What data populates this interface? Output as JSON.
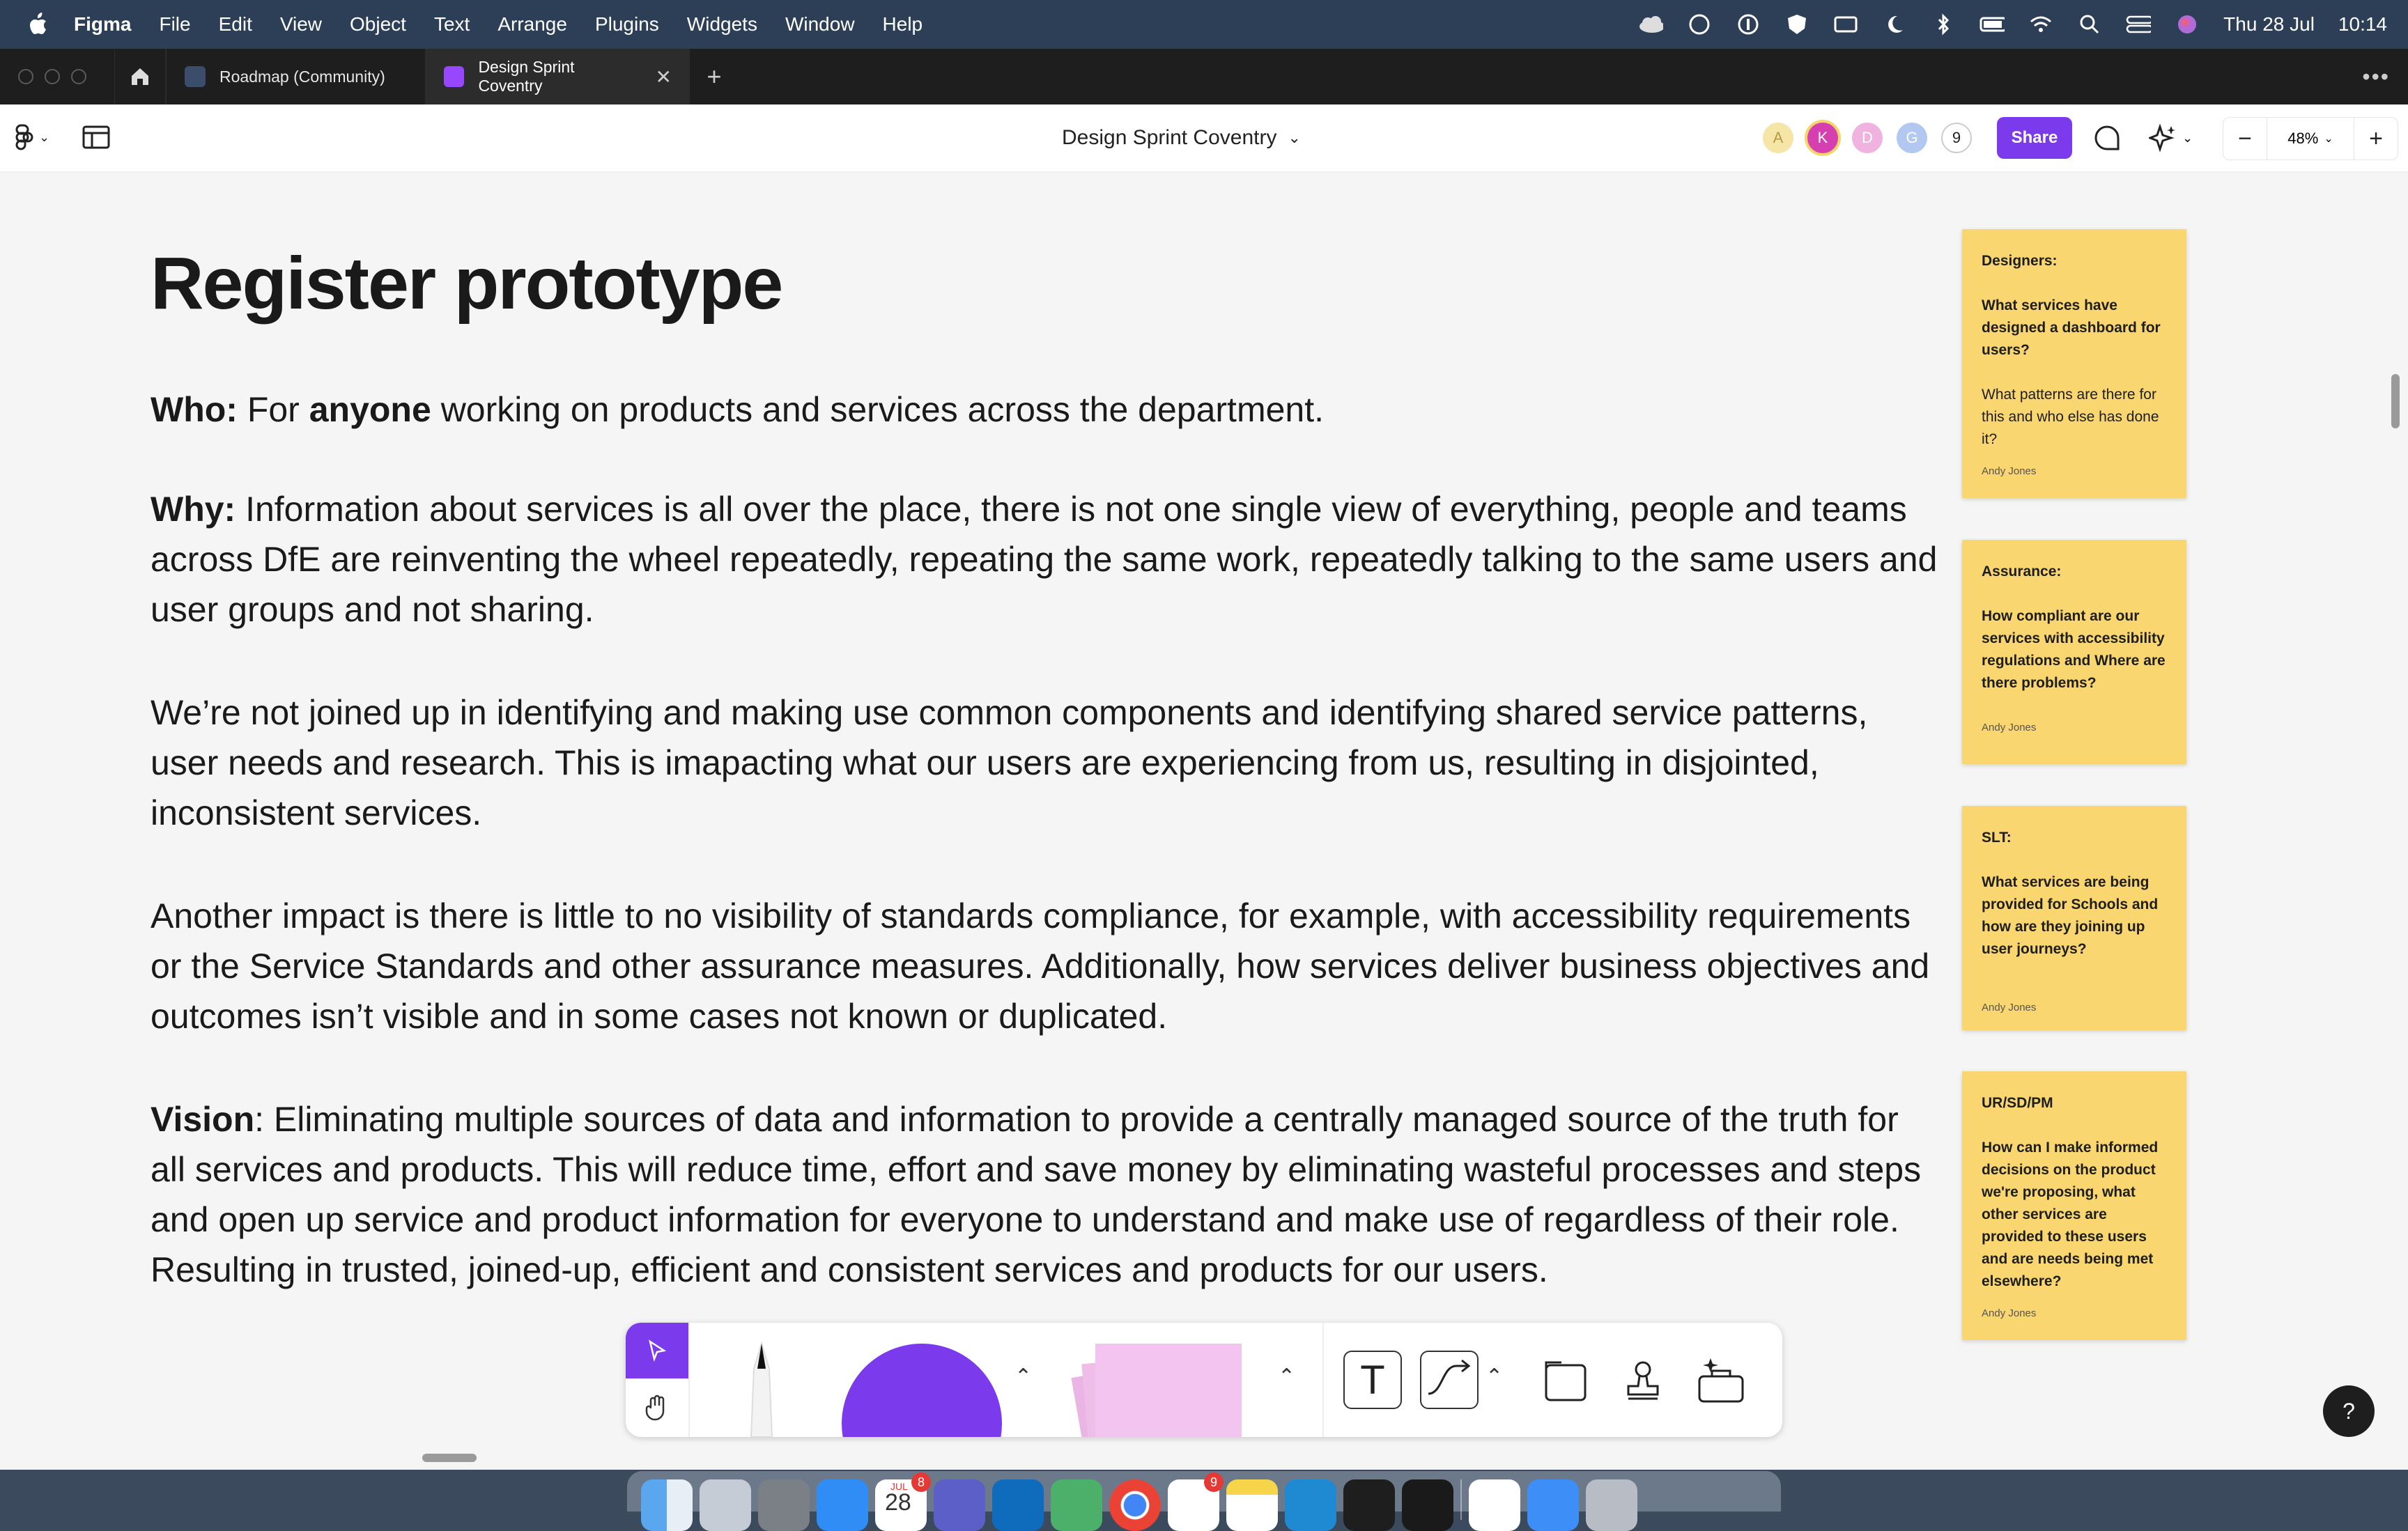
{
  "menubar": {
    "app_name": "Figma",
    "items": [
      "File",
      "Edit",
      "View",
      "Object",
      "Text",
      "Arrange",
      "Plugins",
      "Widgets",
      "Window",
      "Help"
    ],
    "date": "Thu 28 Jul",
    "time": "10:14"
  },
  "tabs": [
    {
      "label": "Roadmap (Community)",
      "icon": "figjam-file-icon",
      "active": false
    },
    {
      "label": "Design Sprint Coventry",
      "icon": "figjam-file-icon",
      "active": true
    }
  ],
  "toolbar": {
    "document_title": "Design Sprint Coventry",
    "avatars": [
      {
        "initial": "A",
        "color": "#f5e6a8"
      },
      {
        "initial": "K",
        "color": "#d63fb0"
      },
      {
        "initial": "D",
        "color": "#f0b3e0"
      },
      {
        "initial": "G",
        "color": "#b3c8f0"
      }
    ],
    "collaborator_count": "9",
    "share_label": "Share",
    "zoom": "48%"
  },
  "canvas": {
    "heading": "Register prototype",
    "paragraphs": {
      "who_label": "Who:",
      "who_text_1": " For ",
      "who_bold": "anyone",
      "who_text_2": " working on products and services across the department.",
      "why_label": "Why:",
      "why_text": " Information about services is all over the place, there is not one single view of everything, people and teams across DfE are reinventing the wheel repeatedly, repeating the same work, repeatedly talking to the same users and user groups and not sharing.",
      "p3": "We’re not joined up in identifying and making use common components and identifying shared service patterns, user needs and research. This is imapacting what our users are experiencing from us, resulting in disjointed, inconsistent services.",
      "p4": "Another impact  is there is little to no visibility of standards compliance, for example, with accessibility requirements or the Service Standards and other assurance measures. Additionally, how services deliver business objectives and outcomes isn’t visible and in some cases not known or duplicated.",
      "vision_label": "Vision",
      "vision_text": ": Eliminating multiple sources of data and information to provide a centrally managed source of the truth for all services and products. This will reduce time, effort and save money by eliminating wasteful processes and steps and open up service and product information for everyone to understand and make use of regardless of their role. Resulting in trusted, joined-up, efficient and consistent services and products for our users."
    },
    "stickies": [
      {
        "title": "Designers:",
        "body": "What services have designed a dashboard for users?",
        "body2": "What patterns are there for this and who else has done it?",
        "author": "Andy Jones"
      },
      {
        "title": "Assurance:",
        "body": "How compliant are our services with accessibility regulations and Where are there problems?",
        "body2": "",
        "author": "Andy Jones"
      },
      {
        "title": "SLT:",
        "body": "What services are being provided for Schools and how are they joining up user journeys?",
        "body2": "",
        "author": "Andy Jones"
      },
      {
        "title": "UR/SD/PM",
        "body": "How can I make informed decisions on the product we're proposing, what other services are provided to these users and are needs being met elsewhere?",
        "body2": "",
        "author": "Andy Jones"
      }
    ]
  },
  "bottom_toolbar": {
    "tools": [
      "select-tool",
      "hand-tool",
      "marker-tool",
      "shape-tool",
      "sticky-note-tool",
      "text-tool",
      "connector-tool",
      "section-tool",
      "stamp-tool",
      "more-tools"
    ],
    "accent": "#7c3aed"
  },
  "help_label": "?",
  "dock": {
    "calendar_month": "JUL",
    "calendar_day": "28",
    "calendar_badge": "8",
    "slack_badge": "9"
  }
}
